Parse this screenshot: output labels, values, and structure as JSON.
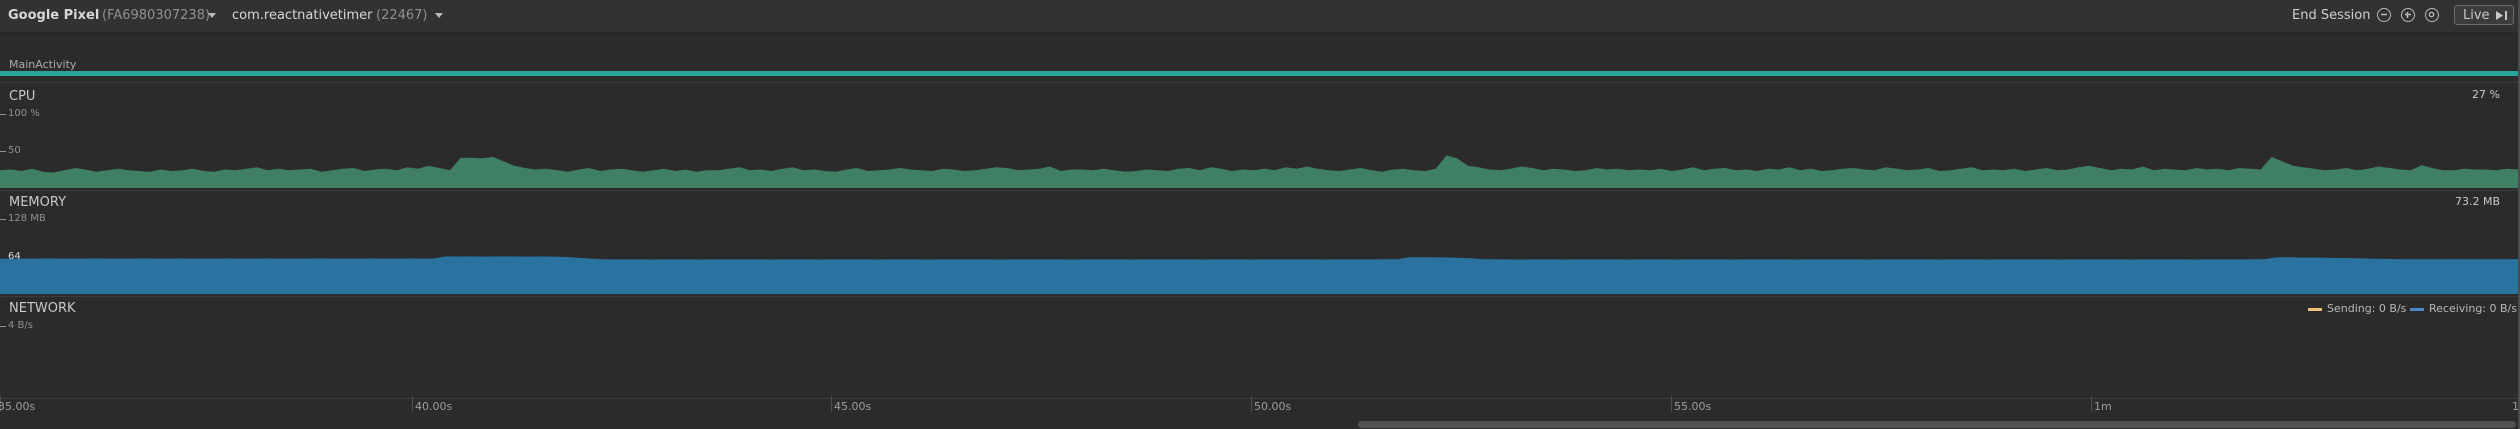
{
  "header": {
    "device_name": "Google Pixel",
    "device_serial": "(FA6980307238)",
    "process_name": "com.reactnativetimer",
    "process_pid": "(22467)",
    "end_session_label": "End Session",
    "live_label": "Live",
    "icons": [
      "zoom-out-icon",
      "zoom-in-icon",
      "reset-zoom-icon",
      "play-pause-icon",
      "chevron-down-icon"
    ]
  },
  "activity": {
    "label": "MainActivity",
    "color": "#26a69a"
  },
  "cpu": {
    "title": "CPU",
    "scale_max": "100 %",
    "scale_mid": "50",
    "current_value": "27 %",
    "color": "#3f7f63",
    "samples": [
      24,
      25,
      23,
      26,
      22,
      21,
      24,
      27,
      25,
      22,
      24,
      26,
      24,
      23,
      22,
      25,
      23,
      24,
      26,
      23,
      22,
      25,
      24,
      26,
      28,
      24,
      26,
      24,
      25,
      26,
      22,
      24,
      26,
      27,
      23,
      25,
      26,
      24,
      28,
      26,
      30,
      27,
      24,
      41,
      41,
      40,
      42,
      36,
      30,
      27,
      25,
      26,
      24,
      22,
      25,
      27,
      23,
      25,
      26,
      24,
      22,
      24,
      26,
      23,
      25,
      22,
      24,
      24,
      26,
      28,
      24,
      25,
      23,
      26,
      28,
      24,
      25,
      23,
      22,
      25,
      27,
      23,
      24,
      25,
      27,
      25,
      24,
      23,
      26,
      25,
      23,
      24,
      26,
      28,
      27,
      24,
      25,
      26,
      29,
      23,
      25,
      25,
      24,
      26,
      24,
      22,
      23,
      25,
      24,
      23,
      26,
      27,
      24,
      28,
      26,
      23,
      25,
      24,
      26,
      24,
      28,
      26,
      29,
      26,
      24,
      23,
      25,
      27,
      24,
      22,
      25,
      26,
      24,
      23,
      26,
      44,
      40,
      30,
      28,
      25,
      24,
      26,
      29,
      27,
      24,
      26,
      25,
      23,
      24,
      27,
      25,
      26,
      24,
      25,
      24,
      26,
      23,
      25,
      28,
      24,
      26,
      27,
      24,
      25,
      23,
      26,
      25,
      28,
      24,
      26,
      23,
      24,
      26,
      27,
      25,
      24,
      28,
      26,
      24,
      25,
      27,
      23,
      24,
      26,
      28,
      24,
      25,
      24,
      26,
      23,
      25,
      27,
      24,
      25,
      28,
      30,
      27,
      24,
      26,
      25,
      29,
      24,
      26,
      25,
      24,
      27,
      25,
      26,
      24,
      27,
      26,
      25,
      42,
      36,
      30,
      28,
      26,
      24,
      25,
      27,
      24,
      26,
      29,
      27,
      25,
      24,
      31,
      27,
      24,
      24,
      26,
      25,
      25,
      24,
      26,
      25
    ],
    "y_max": 100
  },
  "memory": {
    "title": "MEMORY",
    "scale_max": "128 MB",
    "scale_mid": "64",
    "current_value": "73.2 MB",
    "color": "#2a73a1",
    "samples": [
      60.5,
      60.3,
      60.5,
      60.4,
      60.6,
      60.5,
      60.4,
      60.5,
      60.6,
      60.5,
      60.5,
      60.4,
      60.6,
      60.5,
      60.5,
      60.6,
      60.4,
      60.5,
      60.5,
      60.6,
      60.5,
      60.5,
      60.6,
      60.4,
      60.5,
      60.5,
      60.6,
      60.6,
      60.5,
      60.5,
      60.4,
      60.6,
      60.5,
      60.5,
      60.6,
      60.5,
      60.6,
      64.2,
      64.0,
      64.1,
      63.9,
      64.0,
      64.2,
      64.0,
      63.8,
      64.0,
      63.9,
      63.2,
      62.0,
      60.5,
      59.4,
      59.0,
      59.1,
      59.0,
      58.9,
      59.0,
      59.1,
      59.0,
      58.9,
      59.0,
      59.1,
      59.0,
      59.0,
      59.0,
      58.9,
      59.1,
      59.0,
      59.0,
      58.9,
      59.0,
      59.1,
      59.0,
      59.0,
      58.9,
      59.0,
      59.1,
      59.0,
      58.9,
      59.0,
      59.1,
      59.0,
      59.0,
      59.0,
      58.9,
      59.1,
      59.0,
      59.0,
      59.1,
      59.0,
      58.9,
      59.0,
      59.1,
      59.0,
      59.0,
      58.9,
      59.0,
      59.1,
      59.0,
      59.0,
      59.0,
      58.9,
      59.1,
      59.0,
      59.0,
      58.9,
      59.0,
      59.1,
      59.0,
      59.0,
      59.0,
      58.9,
      59.0,
      59.1,
      59.0,
      59.0,
      59.2,
      59.6,
      62.8,
      62.6,
      62.4,
      62.5,
      61.8,
      61.0,
      59.5,
      59.2,
      59.0,
      58.9,
      59.0,
      59.1,
      59.0,
      58.9,
      59.0,
      59.1,
      59.0,
      59.0,
      58.9,
      59.0,
      59.1,
      59.0,
      58.9,
      59.0,
      59.1,
      59.0,
      59.0,
      58.9,
      59.0,
      59.1,
      59.0,
      59.0,
      58.9,
      59.0,
      59.1,
      59.0,
      59.0,
      59.0,
      58.9,
      59.0,
      59.1,
      59.0,
      59.0,
      59.0,
      58.9,
      59.1,
      59.0,
      59.0,
      58.9,
      59.0,
      59.1,
      59.0,
      59.0,
      59.0,
      58.9,
      59.0,
      59.1,
      59.0,
      59.0,
      59.0,
      58.9,
      59.1,
      59.0,
      59.0,
      59.0,
      58.9,
      59.0,
      59.1,
      59.0,
      59.0,
      59.2,
      59.6,
      62.8,
      62.6,
      62.2,
      62.3,
      61.9,
      61.5,
      61.3,
      60.8,
      60.3,
      59.9,
      59.6,
      59.5,
      59.5,
      59.4,
      59.5,
      59.5,
      59.5,
      59.4,
      59.5,
      59.5,
      59.5
    ],
    "y_max": 128
  },
  "network": {
    "title": "NETWORK",
    "scale_max": "4 B/s",
    "sending_label": "Sending: 0 B/s",
    "receiving_label": "Receiving: 0 B/s",
    "sending_color": "#f0c075",
    "receiving_color": "#4a88c7"
  },
  "time_axis": {
    "ticks": [
      "35.00s",
      "40.00s",
      "45.00s",
      "50.00s",
      "55.00s",
      "1m",
      "1"
    ]
  }
}
